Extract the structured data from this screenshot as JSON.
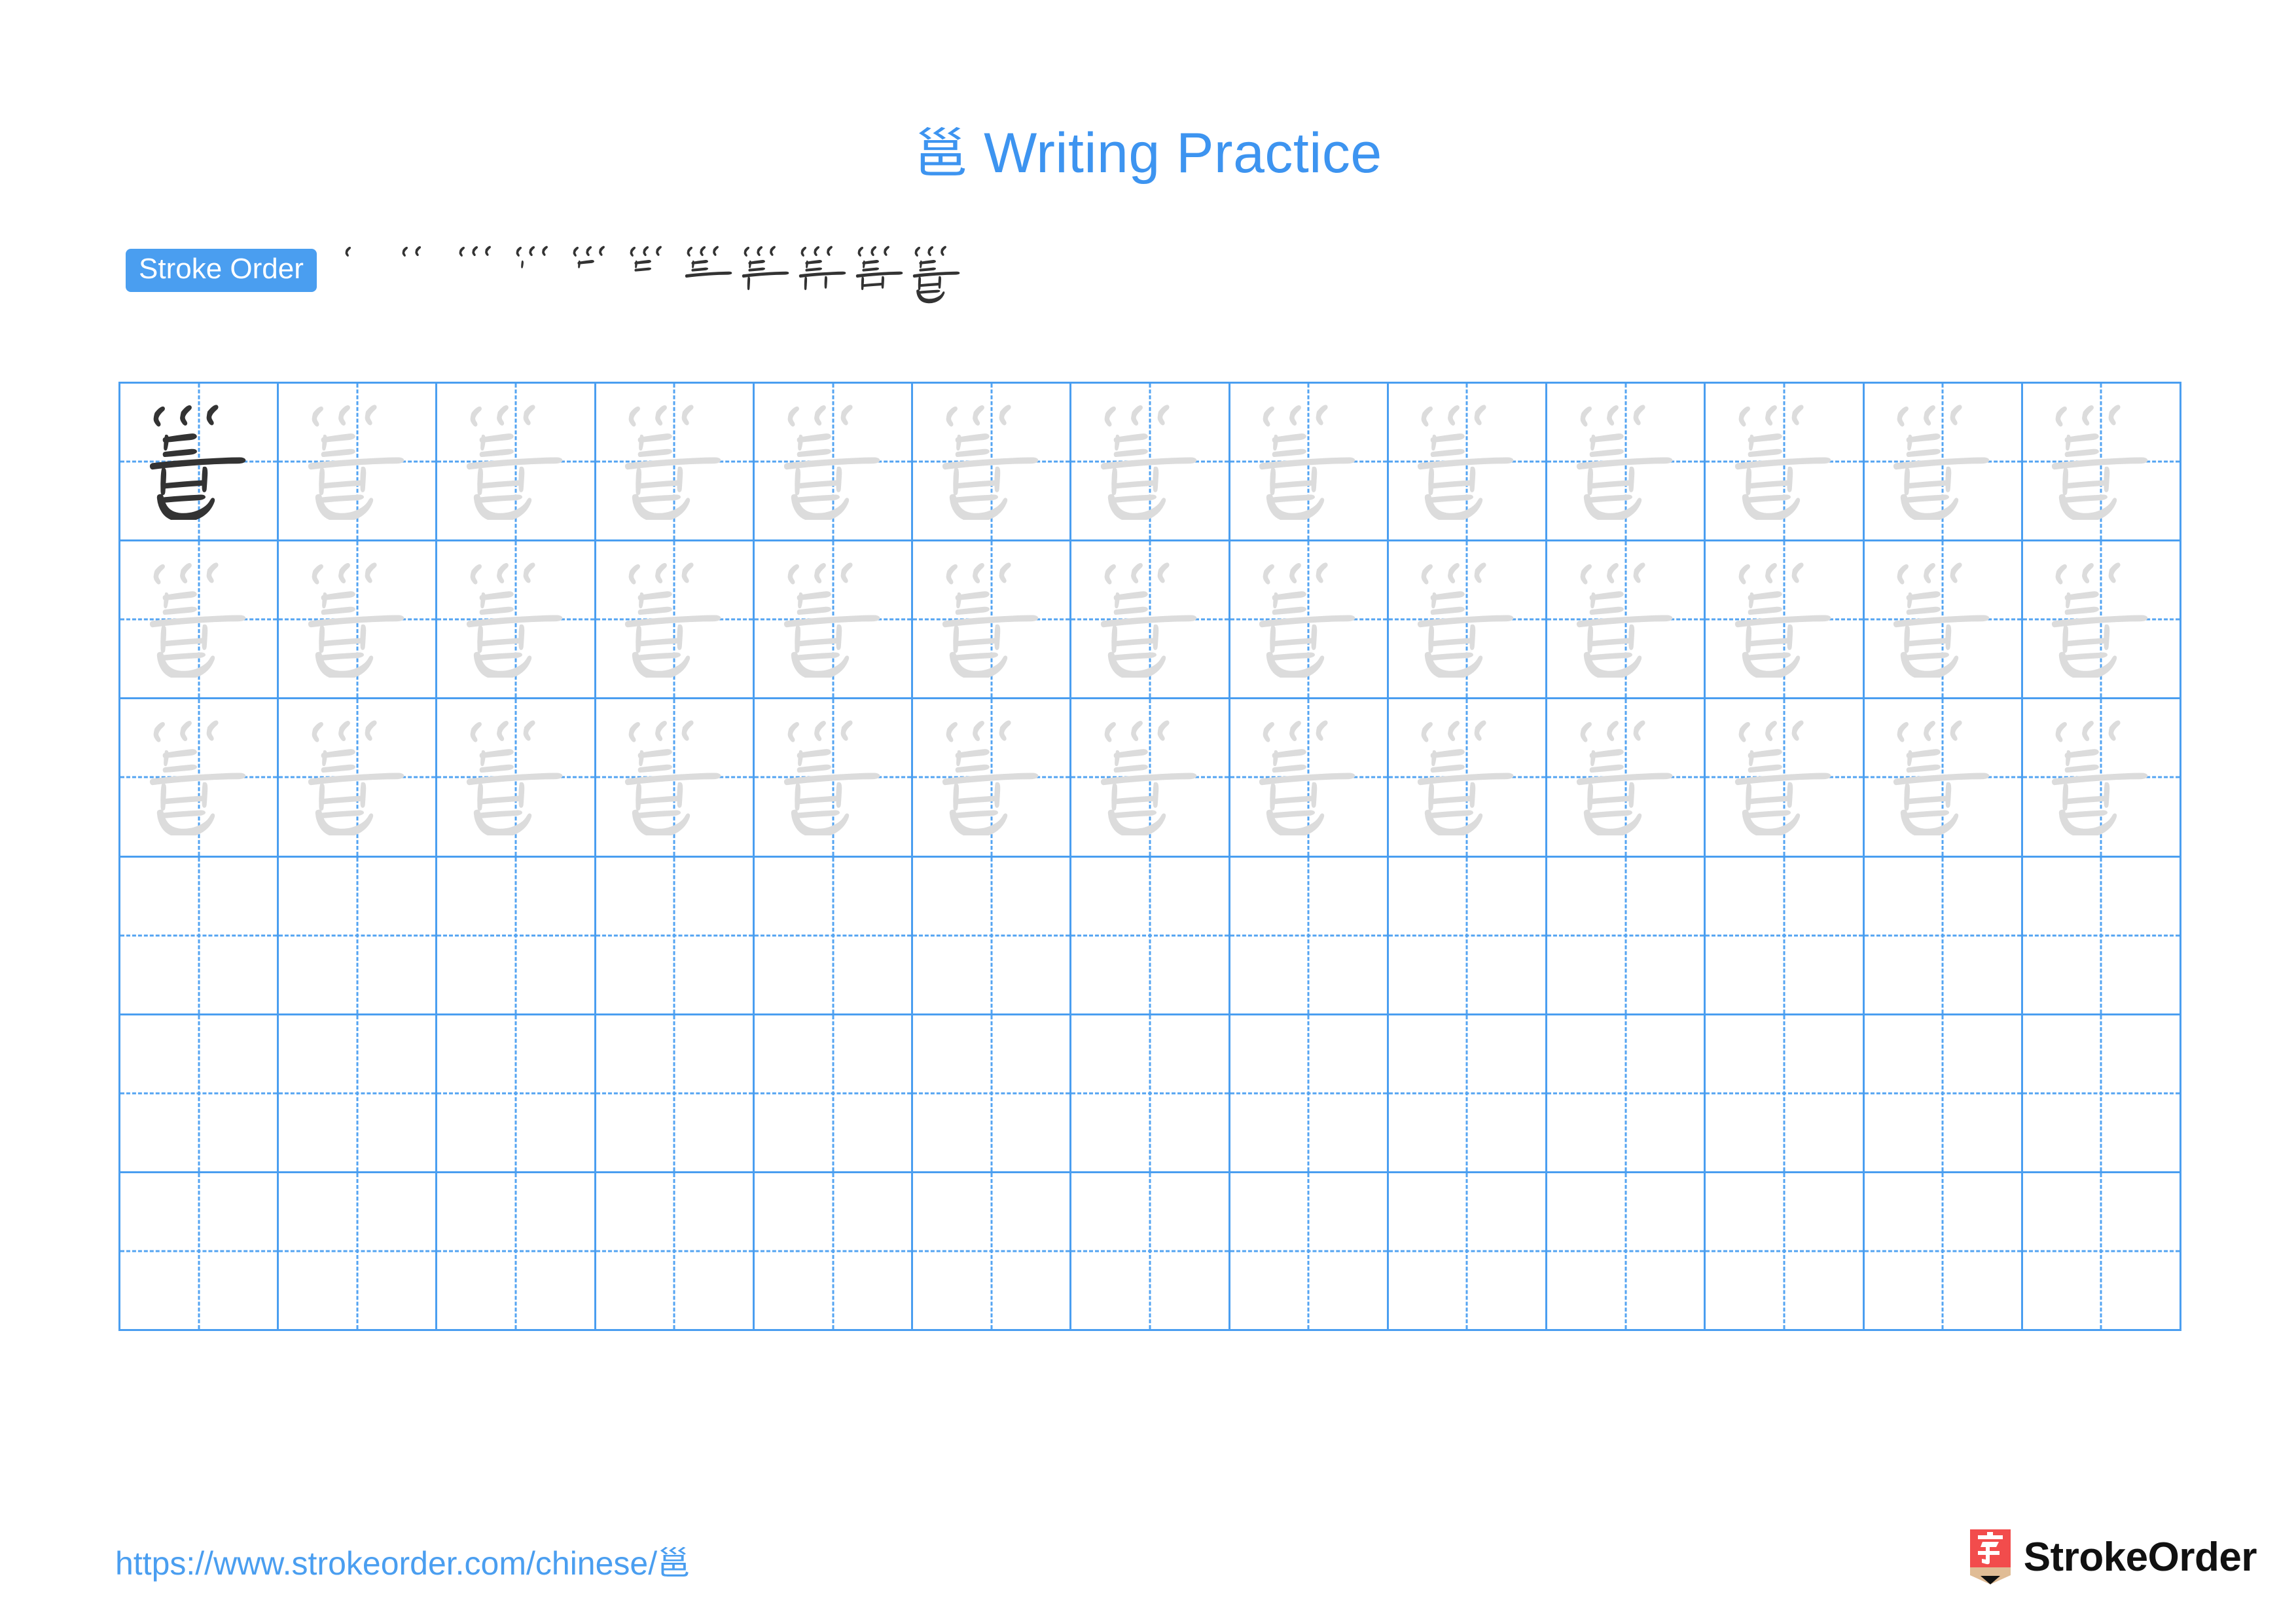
{
  "page": {
    "character": "邕",
    "background_color": "#ffffff",
    "accent_color": "#4a9ef0",
    "title_color": "#3d94f0",
    "stroke_new_color": "#ff0000",
    "stroke_done_color": "#333333",
    "trace_color": "#dcdcdc"
  },
  "title": {
    "character": "邕",
    "text": " Writing Practice",
    "full": "邕 Writing Practice"
  },
  "stroke_order": {
    "label": "Stroke Order",
    "total_strokes": 11,
    "steps": [
      {
        "index": 1,
        "new_stroke": 1
      },
      {
        "index": 2,
        "new_stroke": 2
      },
      {
        "index": 3,
        "new_stroke": 3
      },
      {
        "index": 4,
        "new_stroke": 4
      },
      {
        "index": 5,
        "new_stroke": 5
      },
      {
        "index": 6,
        "new_stroke": 6
      },
      {
        "index": 7,
        "new_stroke": 7
      },
      {
        "index": 8,
        "new_stroke": 8
      },
      {
        "index": 9,
        "new_stroke": 9
      },
      {
        "index": 10,
        "new_stroke": 10
      },
      {
        "index": 11,
        "new_stroke": 11
      }
    ]
  },
  "practice_grid": {
    "columns": 13,
    "rows": 6,
    "filled_rows": 3,
    "empty_rows": 3,
    "first_cell_style": "dark",
    "trace_cell_style": "light",
    "cells": [
      [
        "dark",
        "trace",
        "trace",
        "trace",
        "trace",
        "trace",
        "trace",
        "trace",
        "trace",
        "trace",
        "trace",
        "trace",
        "trace"
      ],
      [
        "trace",
        "trace",
        "trace",
        "trace",
        "trace",
        "trace",
        "trace",
        "trace",
        "trace",
        "trace",
        "trace",
        "trace",
        "trace"
      ],
      [
        "trace",
        "trace",
        "trace",
        "trace",
        "trace",
        "trace",
        "trace",
        "trace",
        "trace",
        "trace",
        "trace",
        "trace",
        "trace"
      ],
      [
        "empty",
        "empty",
        "empty",
        "empty",
        "empty",
        "empty",
        "empty",
        "empty",
        "empty",
        "empty",
        "empty",
        "empty",
        "empty"
      ],
      [
        "empty",
        "empty",
        "empty",
        "empty",
        "empty",
        "empty",
        "empty",
        "empty",
        "empty",
        "empty",
        "empty",
        "empty",
        "empty"
      ],
      [
        "empty",
        "empty",
        "empty",
        "empty",
        "empty",
        "empty",
        "empty",
        "empty",
        "empty",
        "empty",
        "empty",
        "empty",
        "empty"
      ]
    ]
  },
  "footer": {
    "url_prefix": "https://www.strokeorder.com/chinese/",
    "url_character": "邕",
    "url": "https://www.strokeorder.com/chinese/邕",
    "brand_name": "StrokeOrder",
    "logo_character": "字",
    "logo_body_color": "#f24c4c",
    "logo_wood_color": "#e0bc95",
    "logo_tip_color": "#111111"
  }
}
